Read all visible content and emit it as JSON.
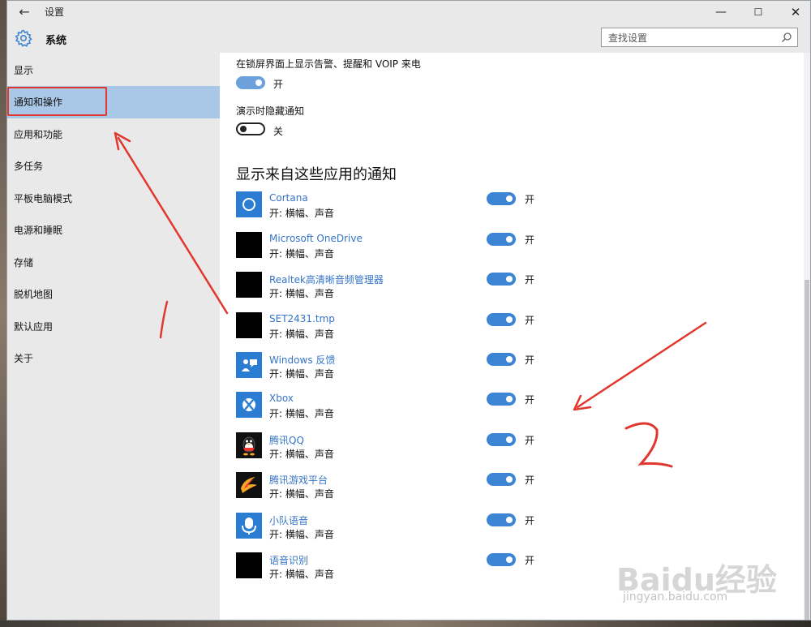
{
  "window": {
    "title": "设置",
    "back_icon": "back-arrow-icon",
    "min_glyph": "—",
    "max_glyph": "☐",
    "close_glyph": "✕"
  },
  "header": {
    "section": "系统",
    "search_placeholder": "查找设置"
  },
  "sidebar": {
    "items": [
      {
        "label": "显示"
      },
      {
        "label": "通知和操作"
      },
      {
        "label": "应用和功能"
      },
      {
        "label": "多任务"
      },
      {
        "label": "平板电脑模式"
      },
      {
        "label": "电源和睡眠"
      },
      {
        "label": "存储"
      },
      {
        "label": "脱机地图"
      },
      {
        "label": "默认应用"
      },
      {
        "label": "关于"
      }
    ],
    "active_index": 1
  },
  "settings": {
    "lockscreen": {
      "label": "在锁屏界面上显示告警、提醒和 VOIP 来电",
      "state": "开",
      "on": true
    },
    "presentation": {
      "label": "演示时隐藏通知",
      "state": "关",
      "on": false
    }
  },
  "apps_section": {
    "title": "显示来自这些应用的通知",
    "apps": [
      {
        "name": "Cortana",
        "sub": "开: 横幅、声音",
        "state": "开",
        "icon": "cortana-icon"
      },
      {
        "name": "Microsoft OneDrive",
        "sub": "开: 横幅、声音",
        "state": "开",
        "icon": "onedrive-icon"
      },
      {
        "name": "Realtek高清晰音频管理器",
        "sub": "开: 横幅、声音",
        "state": "开",
        "icon": "realtek-icon"
      },
      {
        "name": "SET2431.tmp",
        "sub": "开: 横幅、声音",
        "state": "开",
        "icon": "tmp-icon"
      },
      {
        "name": "Windows 反馈",
        "sub": "开: 横幅、声音",
        "state": "开",
        "icon": "feedback-icon"
      },
      {
        "name": "Xbox",
        "sub": "开: 横幅、声音",
        "state": "开",
        "icon": "xbox-icon"
      },
      {
        "name": "腾讯QQ",
        "sub": "开: 横幅、声音",
        "state": "开",
        "icon": "qq-icon"
      },
      {
        "name": "腾讯游戏平台",
        "sub": "开: 横幅、声音",
        "state": "开",
        "icon": "tencent-games-icon"
      },
      {
        "name": "小队语音",
        "sub": "开: 横幅、声音",
        "state": "开",
        "icon": "microphone-icon"
      },
      {
        "name": "语音识别",
        "sub": "开: 横幅、声音",
        "state": "开",
        "icon": "speech-icon"
      }
    ]
  },
  "watermark": {
    "text": "Baidu经验",
    "url": "jingyan.baidu.com"
  },
  "colors": {
    "accent": "#3c84d4",
    "sidebar_bg": "#e9e9e9",
    "active_bg": "#a9c7e6",
    "annotation_red": "#e0382f"
  }
}
